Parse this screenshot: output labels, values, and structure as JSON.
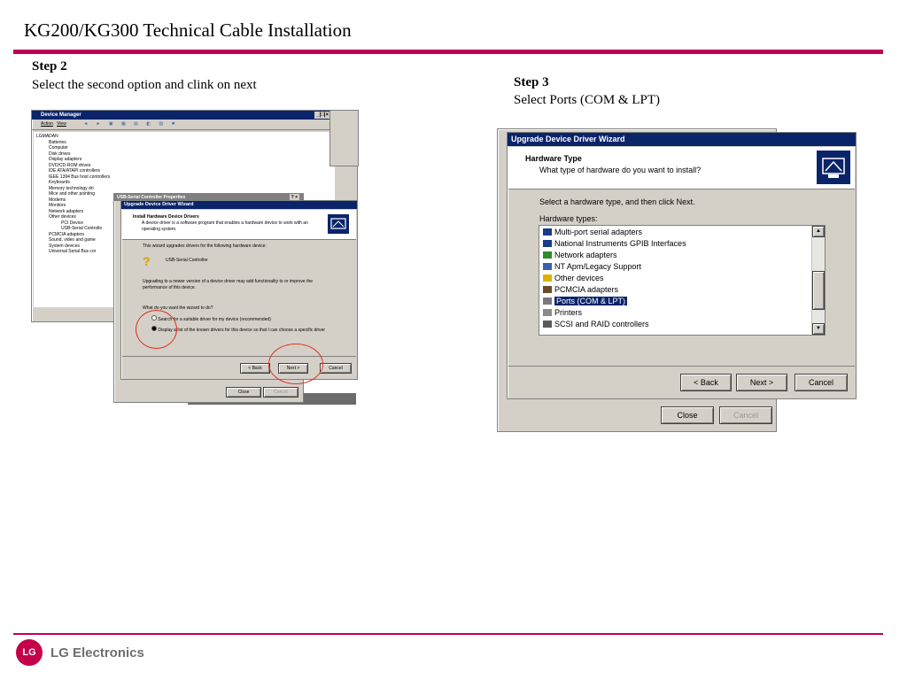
{
  "page_title": "KG200/KG300 Technical Cable Installation",
  "step2": {
    "heading": "Step 2",
    "text": "Select the second option and clink on next"
  },
  "step3": {
    "heading": "Step 3",
    "text": "Select Ports (COM & LPT)"
  },
  "device_manager": {
    "title": "Device Manager",
    "controls": "_|□|×",
    "menu": [
      "Action",
      "View"
    ],
    "tree": [
      "LGMADAN",
      "Batteries",
      "Computer",
      "Disk drives",
      "Display adapters",
      "DVD/CD-ROM drives",
      "IDE ATA/ATAPI controllers",
      "IEEE 1394 Bus host controllers",
      "Keyboards",
      "Memory technology dri",
      "Mice and other pointing",
      "Modems",
      "Monitors",
      "Network adapters",
      "Other devices",
      "PCI Device",
      "USB-Serial Controlle",
      "PCMCIA adapters",
      "Sound, video and game",
      "System devices",
      "Universal Serial Bus cor"
    ]
  },
  "usb_props": {
    "title": "USB-Serial Controller Properties",
    "controls": "? ×",
    "close": "Close",
    "cancel": "Cancel"
  },
  "small_wizard": {
    "title": "Upgrade Device Driver Wizard",
    "heading": "Install Hardware Device Drivers",
    "subheading": "A device driver is a software program that enables a hardware device to work with an operating system.",
    "intro": "This wizard upgrades drivers for the following hardware device:",
    "device": "USB-Serial Controller",
    "upgrade_text": "Upgrading to a newer version of a device driver may add functionality to or improve the performance of this device.",
    "question": "What do you want the wizard to do?",
    "option1": "Search for a suitable driver for my device (recommended)",
    "option2": "Display a list of the known drivers for this device so that I can choose a specific driver",
    "back": "< Back",
    "next": "Next >",
    "cancel": "Cancel"
  },
  "large_wizard": {
    "title": "Upgrade Device Driver Wizard",
    "heading": "Hardware Type",
    "subheading": "What type of hardware do you want to install?",
    "instruction": "Select a hardware type, and then click Next.",
    "list_label": "Hardware types:",
    "hardware_types": [
      "Multi-port serial adapters",
      "National Instruments GPIB Interfaces",
      "Network adapters",
      "NT Apm/Legacy Support",
      "Other devices",
      "PCMCIA adapters",
      "Ports (COM & LPT)",
      "Printers",
      "SCSI and RAID controllers"
    ],
    "selected": "Ports (COM & LPT)",
    "back": "< Back",
    "next": "Next >",
    "cancel": "Cancel",
    "close": "Close",
    "cancel2": "Cancel"
  },
  "footer": {
    "brand": "LG Electronics",
    "logo_mark": "LG"
  },
  "colors": {
    "accent": "#c0005a",
    "titlebar": "#0a246a",
    "highlight": "#e0301e"
  }
}
